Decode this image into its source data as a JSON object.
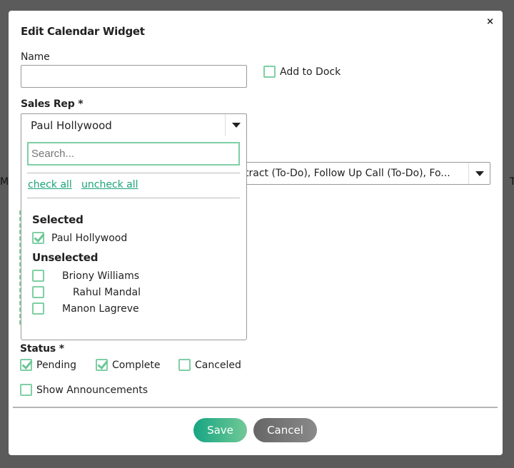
{
  "background": {
    "left_text": "Mo",
    "right_text": "T"
  },
  "modal": {
    "title": "Edit Calendar Widget",
    "close_label": "×",
    "name_label": "Name",
    "name_value": "",
    "add_to_dock_label": "Add to Dock",
    "add_to_dock_checked": false,
    "sales_rep_label": "Sales Rep *",
    "sales_rep_value": "Paul Hollywood",
    "types_value": "tract (To-Do), Follow Up Call (To-Do), Fo...",
    "dropdown": {
      "search_placeholder": "Search...",
      "check_all": "check all",
      "uncheck_all": "uncheck all",
      "selected_heading": "Selected",
      "selected": [
        {
          "label": "Paul Hollywood",
          "checked": true
        }
      ],
      "unselected_heading": "Unselected",
      "unselected": [
        {
          "label": "Briony Williams",
          "checked": false
        },
        {
          "label": "Rahul Mandal",
          "checked": false
        },
        {
          "label": "Manon Lagreve",
          "checked": false
        }
      ]
    },
    "status_label": "Status *",
    "status_options": [
      {
        "label": "Pending",
        "checked": true
      },
      {
        "label": "Complete",
        "checked": true
      },
      {
        "label": "Canceled",
        "checked": false
      }
    ],
    "show_announcements_label": "Show Announcements",
    "show_announcements_checked": false,
    "save_label": "Save",
    "cancel_label": "Cancel"
  },
  "colors": {
    "accent": "#1aa37a",
    "checkbox": "#7fcfa5",
    "cancel": "#6e6e6e"
  }
}
